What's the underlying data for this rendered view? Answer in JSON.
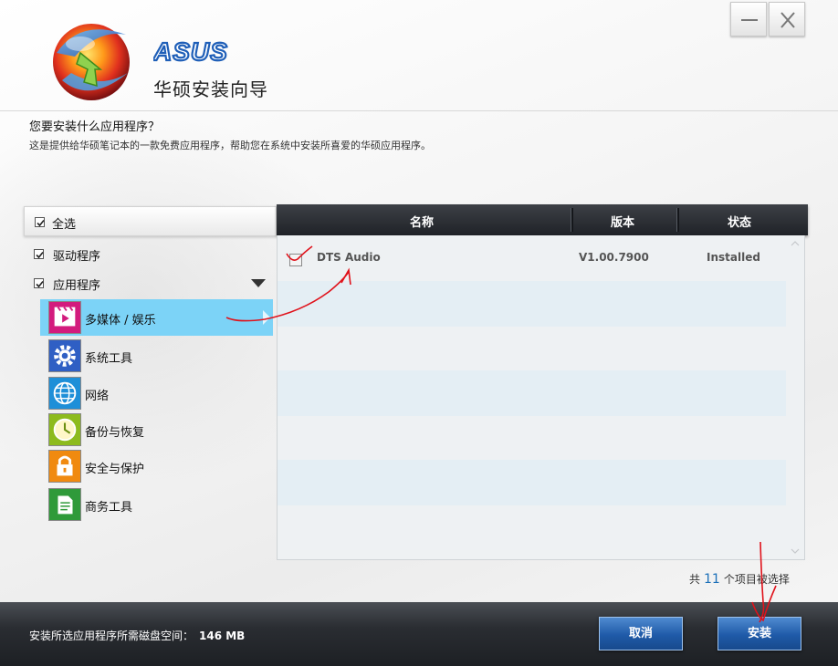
{
  "window": {
    "brand": "ASUS",
    "title": "华硕安装向导",
    "minimize_icon": "minimize-icon",
    "close_icon": "close-icon"
  },
  "intro": {
    "question": "您要安装什么应用程序？",
    "description": "这是提供给华硕笔记本的一款免费应用程序，帮助您在系统中安装所喜爱的华硕应用程序。"
  },
  "sidebar": {
    "select_all": "全选",
    "groups": [
      {
        "label": "驱动程序"
      },
      {
        "label": "应用程序"
      }
    ],
    "categories": [
      {
        "label": "多媒体 / 娱乐",
        "icon": "multimedia-icon",
        "color": "#d31b7d",
        "selected": true
      },
      {
        "label": "系统工具",
        "icon": "gear-icon",
        "color": "#2f5fc4"
      },
      {
        "label": "网络",
        "icon": "globe-icon",
        "color": "#1e8fd8"
      },
      {
        "label": "备份与恢复",
        "icon": "clock-icon",
        "color": "#8dbb1d"
      },
      {
        "label": "安全与保护",
        "icon": "lock-icon",
        "color": "#f08a10"
      },
      {
        "label": "商务工具",
        "icon": "document-icon",
        "color": "#2f9a3a"
      }
    ]
  },
  "table": {
    "columns": [
      "名称",
      "版本",
      "状态"
    ],
    "rows": [
      {
        "name": "DTS Audio",
        "version": "V1.00.7900",
        "status": "Installed"
      }
    ]
  },
  "summary": {
    "prefix": "共",
    "count": "11",
    "suffix": "个项目被选择"
  },
  "footer": {
    "disk_label": "安装所选应用程序所需磁盘空间：",
    "disk_value": "146 MB",
    "cancel_label": "取消",
    "install_label": "安装"
  },
  "colors": {
    "selected_row": "#7cd3f7",
    "button": "#1f5aa8",
    "annotation": "#e0121b"
  }
}
